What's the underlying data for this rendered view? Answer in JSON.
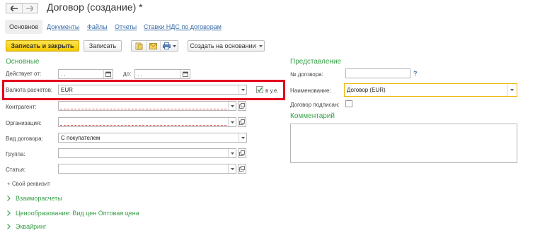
{
  "header": {
    "title": "Договор (создание) *",
    "back_icon": "arrow-left-icon",
    "forward_icon": "arrow-right-icon"
  },
  "tabs": [
    {
      "label": "Основное",
      "active": true
    },
    {
      "label": "Документы"
    },
    {
      "label": "Файлы"
    },
    {
      "label": "Отчеты"
    },
    {
      "label": "Ставки НДС по договорам"
    }
  ],
  "toolbar": {
    "save_close_label": "Записать и закрыть",
    "save_label": "Записать",
    "create_based_label": "Создать на основании",
    "icons": [
      "document-icon",
      "envelope-icon",
      "printer-icon"
    ]
  },
  "main": {
    "section_title": "Основные",
    "valid_from_label": "Действует от:",
    "valid_from_value": " .  .",
    "valid_to_label": "до:",
    "valid_to_value": " .  .",
    "currency_label": "Валюта расчетов:",
    "currency_value": "EUR",
    "in_ue_label": "в у.е.",
    "in_ue_checked": true,
    "counterparty_label": "Контрагент:",
    "organization_label": "Организация:",
    "contract_type_label": "Вид договора:",
    "contract_type_value": "С покупателем",
    "group_label": "Группа:",
    "article_label": "Статья:",
    "custom_attr_label": "+ Свой реквизит"
  },
  "expanders": [
    {
      "label": "Взаиморасчеты"
    },
    {
      "label": "Ценообразование: Вид цен Оптовая цена"
    },
    {
      "label": "Эквайринг"
    }
  ],
  "presentation": {
    "section_title": "Представление",
    "number_label": "№ договора:",
    "help_mark": "?",
    "name_label": "Наименование:",
    "name_value": "Договор (EUR)",
    "signed_label": "Договор подписан:",
    "signed_checked": false,
    "comment_title": "Комментарий"
  },
  "colors": {
    "accent_green": "#38a048",
    "link_blue": "#3b6ea8",
    "primary_yellow": "#f5c900",
    "highlight_red": "#e3001b",
    "focus_orange": "#f0b400"
  }
}
